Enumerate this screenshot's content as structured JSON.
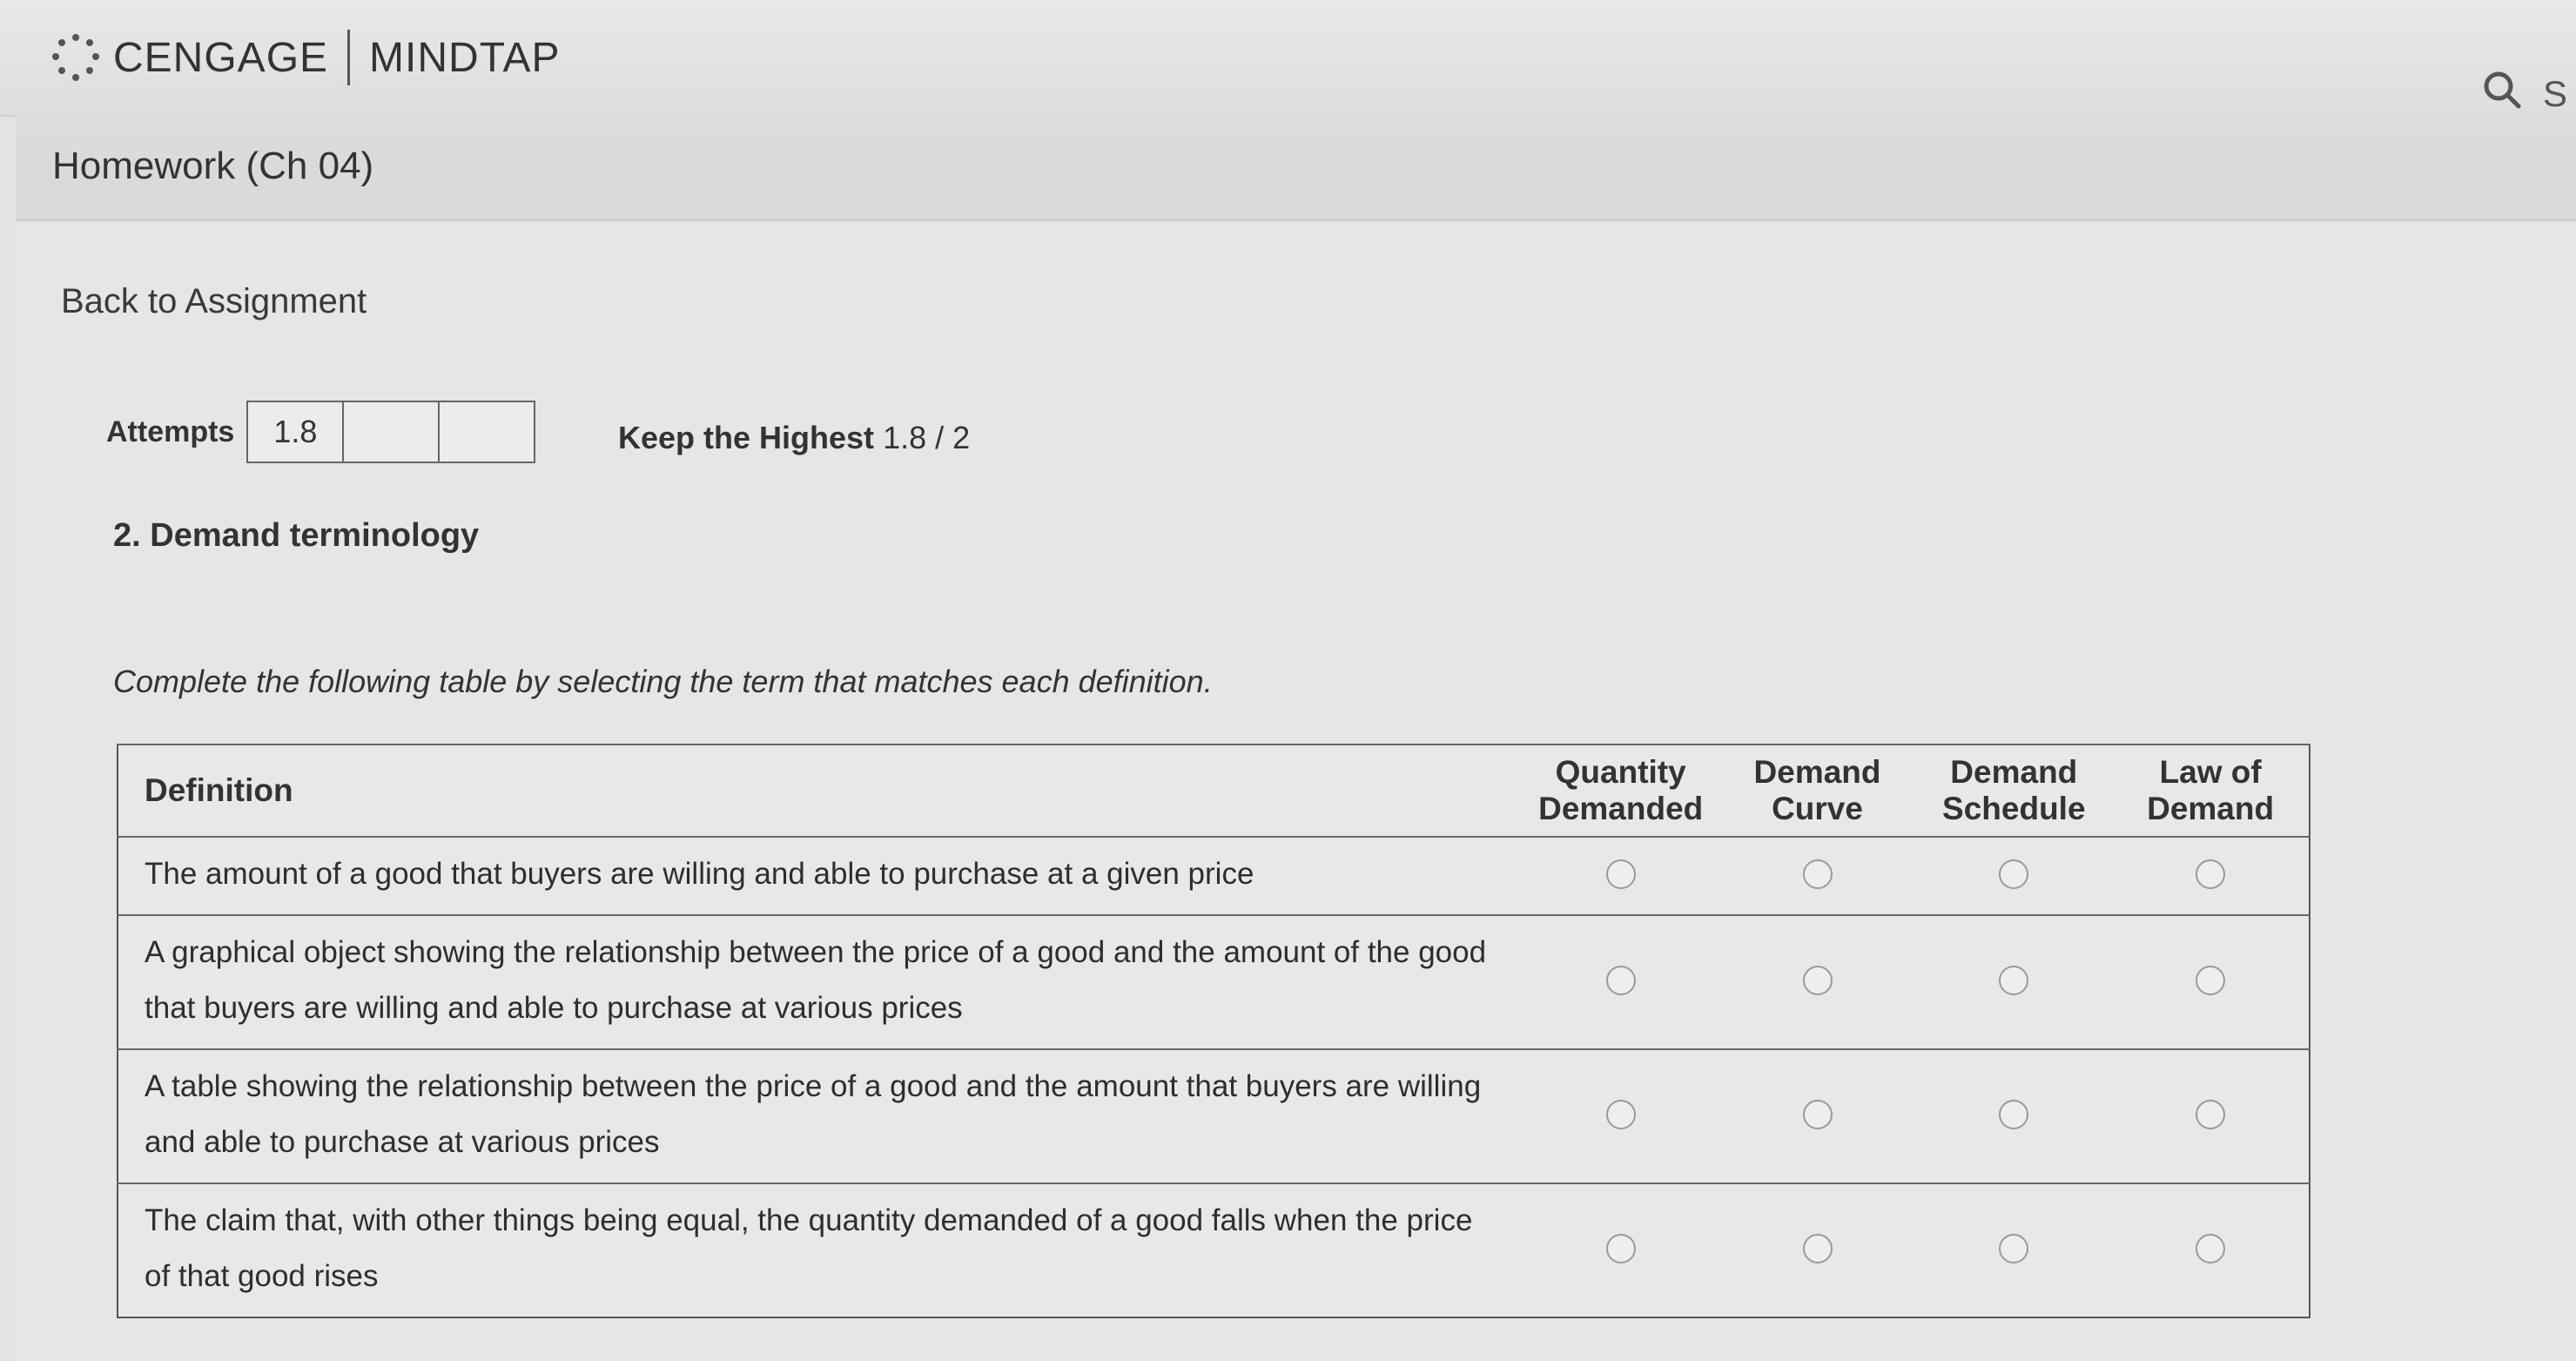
{
  "brand": {
    "left": "CENGAGE",
    "right": "MINDTAP"
  },
  "header": {
    "search_letter": "S"
  },
  "assignment": {
    "title": "Homework (Ch 04)",
    "back_label": "Back to Assignment"
  },
  "attempts": {
    "label": "Attempts",
    "values": [
      "1.8",
      "",
      ""
    ],
    "keep_label": "Keep the Highest",
    "keep_value": "1.8 / 2"
  },
  "question": {
    "title": "2. Demand terminology",
    "instruction": "Complete the following table by selecting the term that matches each definition.",
    "table": {
      "definition_header": "Definition",
      "columns": [
        {
          "line1": "Quantity",
          "line2": "Demanded"
        },
        {
          "line1": "Demand",
          "line2": "Curve"
        },
        {
          "line1": "Demand",
          "line2": "Schedule"
        },
        {
          "line1": "Law of",
          "line2": "Demand"
        }
      ],
      "rows": [
        {
          "definition": "The amount of a good that buyers are willing and able to purchase at a given price"
        },
        {
          "definition": "A graphical object showing the relationship between the price of a good and the amount of the good that buyers are willing and able to purchase at various prices"
        },
        {
          "definition": "A table showing the relationship between the price of a good and the amount that buyers are willing and able to purchase at various prices"
        },
        {
          "definition": "The claim that, with other things being equal, the quantity demanded of a good falls when the price of that good rises"
        }
      ]
    }
  }
}
